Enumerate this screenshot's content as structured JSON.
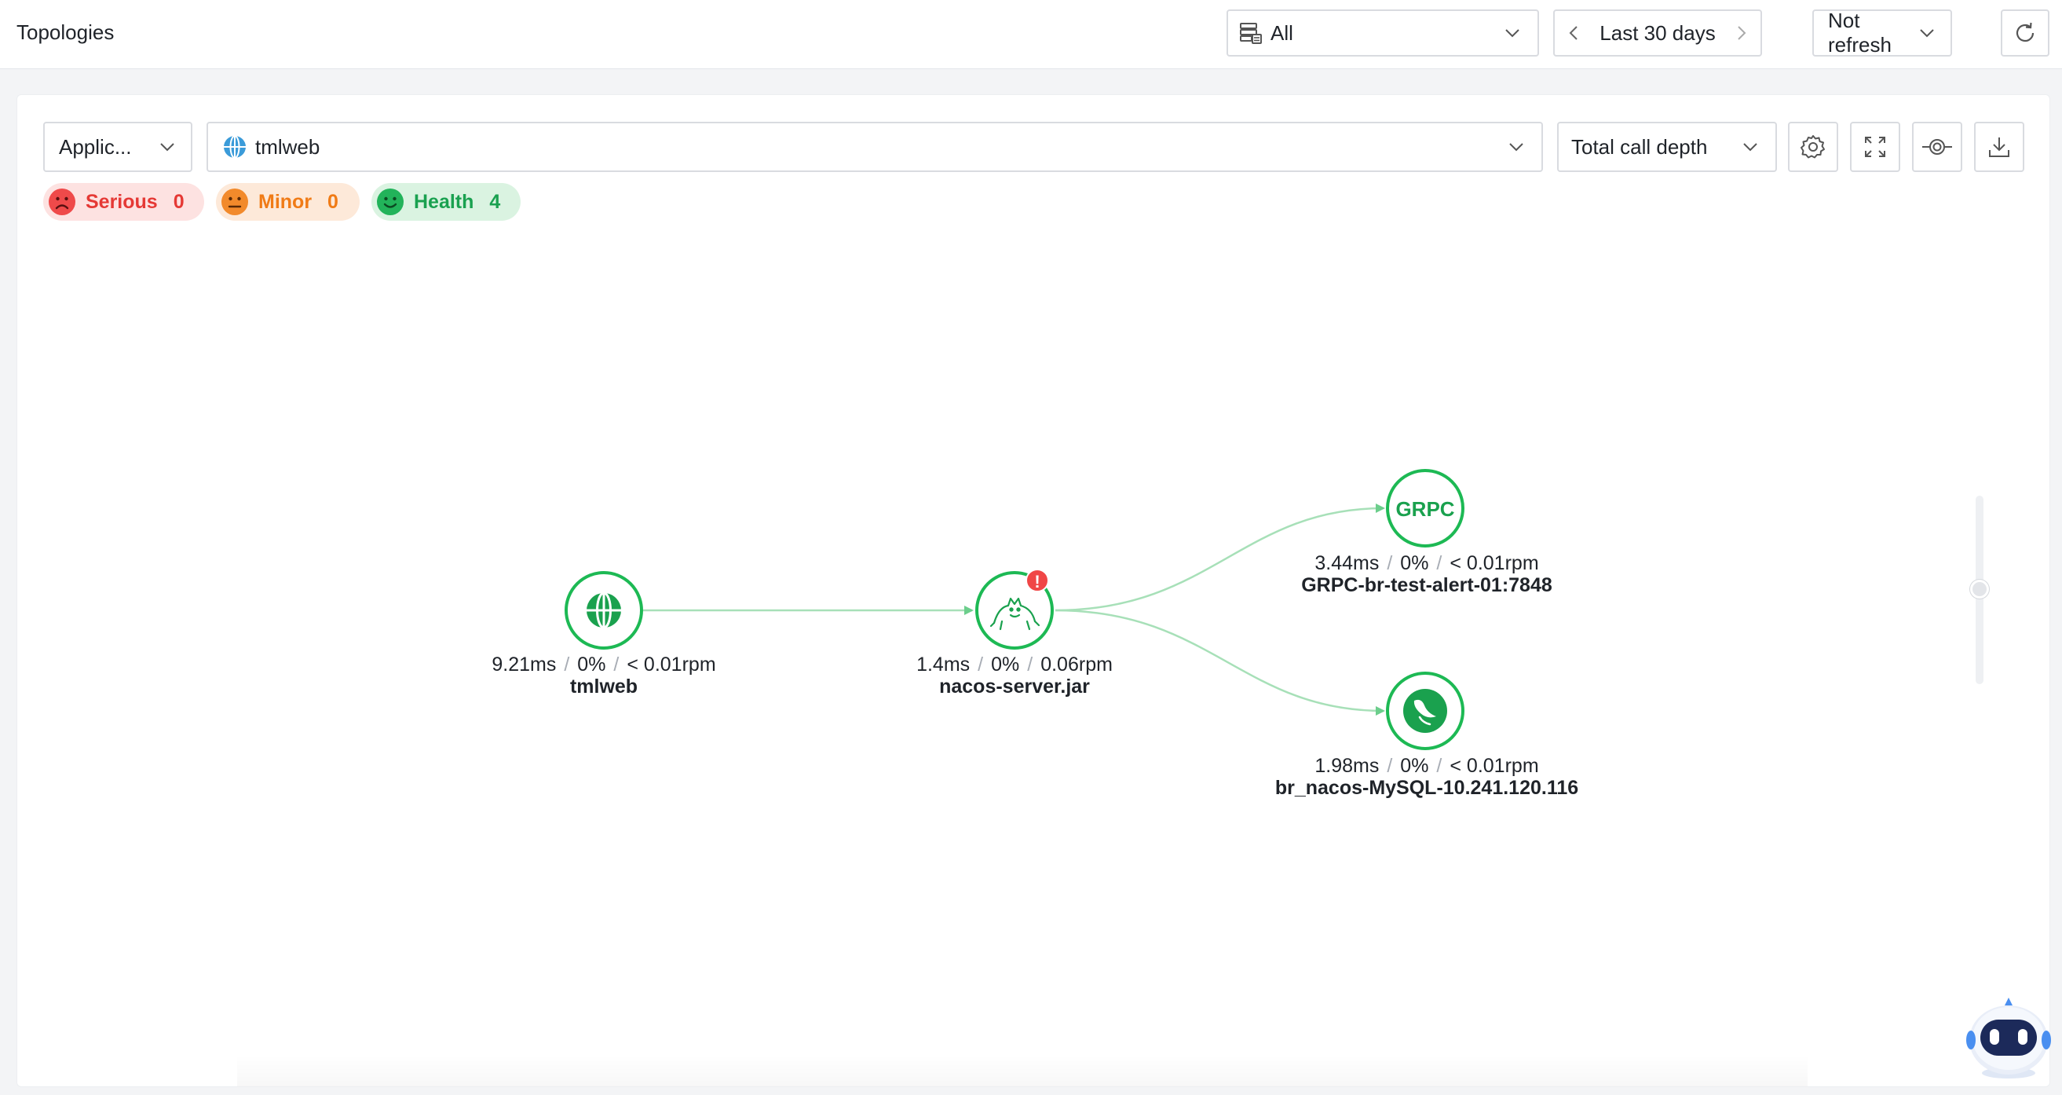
{
  "header": {
    "title": "Topologies",
    "scope_label": "All",
    "time_range": "Last 30 days",
    "refresh": "Not refresh"
  },
  "toolbar": {
    "type_select": "Applic...",
    "app_select": "tmlweb",
    "depth_select": "Total call depth"
  },
  "status_badges": {
    "serious": {
      "label": "Serious",
      "count": "0"
    },
    "minor": {
      "label": "Minor",
      "count": "0"
    },
    "health": {
      "label": "Health",
      "count": "4"
    }
  },
  "nodes": [
    {
      "id": "tmlweb",
      "name": "tmlweb",
      "latency": "9.21ms",
      "error_rate": "0%",
      "throughput": "< 0.01rpm",
      "icon": "globe-icon"
    },
    {
      "id": "nacos",
      "name": "nacos-server.jar",
      "latency": "1.4ms",
      "error_rate": "0%",
      "throughput": "0.06rpm",
      "icon": "tomcat-icon",
      "alert": "!"
    },
    {
      "id": "grpc",
      "name": "GRPC-br-test-alert-01:7848",
      "latency": "3.44ms",
      "error_rate": "0%",
      "throughput": "< 0.01rpm",
      "icon": "grpc-icon",
      "icon_text": "GRPC"
    },
    {
      "id": "mysql",
      "name": "br_nacos-MySQL-10.241.120.116",
      "latency": "1.98ms",
      "error_rate": "0%",
      "throughput": "< 0.01rpm",
      "icon": "mysql-icon"
    }
  ],
  "edges": [
    {
      "from": "tmlweb",
      "to": "nacos"
    },
    {
      "from": "nacos",
      "to": "grpc"
    },
    {
      "from": "nacos",
      "to": "mysql"
    }
  ],
  "colors": {
    "node_border": "#1db954",
    "edge": "#9fdcb0",
    "alert": "#f04646",
    "serious": "#e53935",
    "minor": "#f07b16",
    "health": "#1aa150"
  }
}
